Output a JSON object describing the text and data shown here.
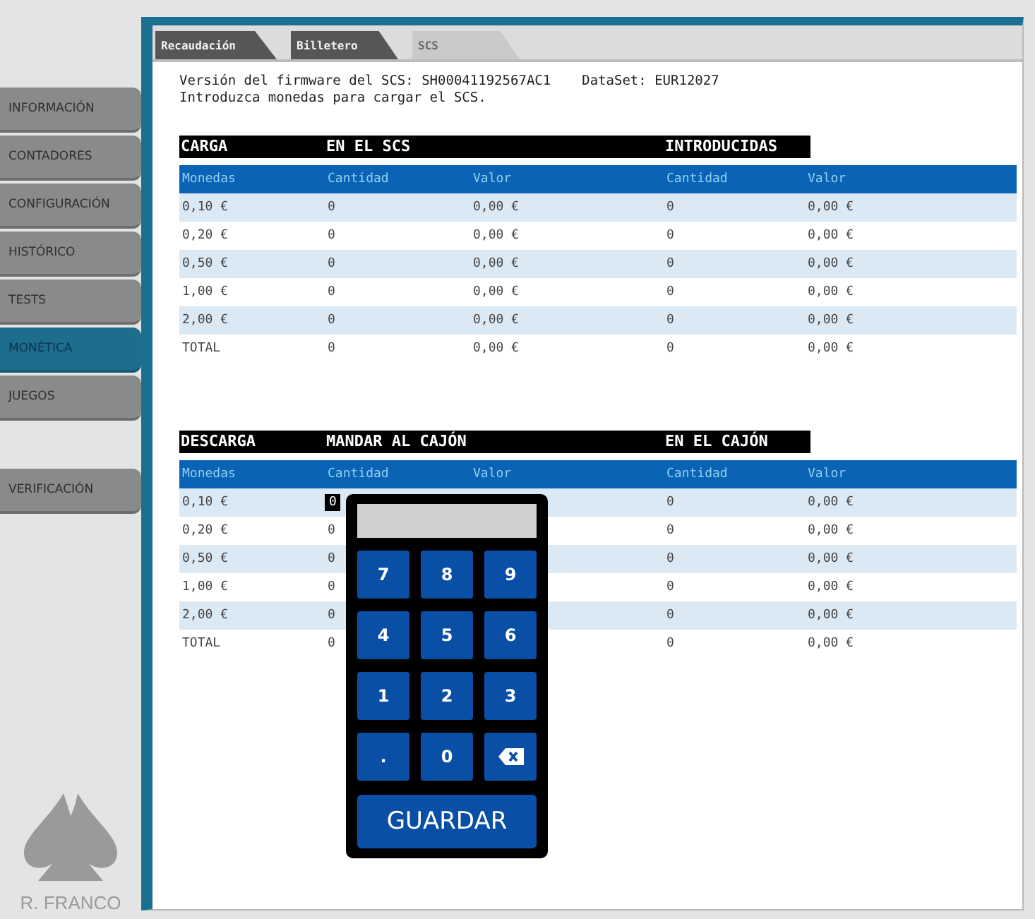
{
  "sidebar": {
    "items": [
      {
        "label": "INFORMACIÓN",
        "selected": false
      },
      {
        "label": "CONTADORES",
        "selected": false
      },
      {
        "label": "CONFIGURACIÓN",
        "selected": false
      },
      {
        "label": "HISTÓRICO",
        "selected": false
      },
      {
        "label": "TESTS",
        "selected": false
      },
      {
        "label": "MONÉTICA",
        "selected": true
      },
      {
        "label": "JUEGOS",
        "selected": false
      }
    ],
    "extra_items": [
      {
        "label": "VERIFICACIÓN",
        "selected": false
      }
    ],
    "logo_text": "R. FRANCO"
  },
  "tabs": [
    {
      "label": "Recaudación",
      "selected": false
    },
    {
      "label": "Billetero",
      "selected": false
    },
    {
      "label": "SCS",
      "selected": true
    }
  ],
  "info": {
    "firmware": "Versión del firmware del SCS: SH00041192567AC1",
    "dataset": "DataSet: EUR12027",
    "instruction": "Introduzca monedas para cargar el SCS."
  },
  "carga": {
    "titles": {
      "section": "CARGA",
      "left": "EN EL SCS",
      "right": "INTRODUCIDAS"
    },
    "columns": [
      "Monedas",
      "Cantidad",
      "Valor",
      "Cantidad",
      "Valor"
    ],
    "rows": [
      [
        "0,10 €",
        "0",
        "0,00 €",
        "0",
        "0,00 €"
      ],
      [
        "0,20 €",
        "0",
        "0,00 €",
        "0",
        "0,00 €"
      ],
      [
        "0,50 €",
        "0",
        "0,00 €",
        "0",
        "0,00 €"
      ],
      [
        "1,00 €",
        "0",
        "0,00 €",
        "0",
        "0,00 €"
      ],
      [
        "2,00 €",
        "0",
        "0,00 €",
        "0",
        "0,00 €"
      ],
      [
        "TOTAL",
        "0",
        "0,00 €",
        "0",
        "0,00 €"
      ]
    ]
  },
  "descarga": {
    "titles": {
      "section": "DESCARGA",
      "left": "MANDAR AL CAJÓN",
      "right": "EN EL CAJÓN"
    },
    "columns": [
      "Monedas",
      "Cantidad",
      "Valor",
      "Cantidad",
      "Valor"
    ],
    "rows": [
      {
        "coin": "0,10 €",
        "cantidad": "0",
        "cantidad_selected": true,
        "cajon_cantidad": "0",
        "cajon_valor": "0,00 €"
      },
      {
        "coin": "0,20 €",
        "cantidad": "0",
        "cantidad_selected": false,
        "cajon_cantidad": "0",
        "cajon_valor": "0,00 €"
      },
      {
        "coin": "0,50 €",
        "cantidad": "0",
        "cantidad_selected": false,
        "cajon_cantidad": "0",
        "cajon_valor": "0,00 €"
      },
      {
        "coin": "1,00 €",
        "cantidad": "0",
        "cantidad_selected": false,
        "cajon_cantidad": "0",
        "cajon_valor": "0,00 €"
      },
      {
        "coin": "2,00 €",
        "cantidad": "0",
        "cantidad_selected": false,
        "cajon_cantidad": "0",
        "cajon_valor": "0,00 €"
      },
      {
        "coin": "TOTAL",
        "cantidad": "0",
        "cantidad_selected": false,
        "cajon_cantidad": "0",
        "cajon_valor": "0,00 €"
      }
    ]
  },
  "numpad": {
    "keys": [
      {
        "kind": "digit",
        "label": "7"
      },
      {
        "kind": "digit",
        "label": "8"
      },
      {
        "kind": "digit",
        "label": "9"
      },
      {
        "kind": "digit",
        "label": "4"
      },
      {
        "kind": "digit",
        "label": "5"
      },
      {
        "kind": "digit",
        "label": "6"
      },
      {
        "kind": "digit",
        "label": "1"
      },
      {
        "kind": "digit",
        "label": "2"
      },
      {
        "kind": "digit",
        "label": "3"
      },
      {
        "kind": "digit",
        "label": "."
      },
      {
        "kind": "digit",
        "label": "0"
      },
      {
        "kind": "backspace"
      }
    ],
    "save_label": "GUARDAR"
  }
}
